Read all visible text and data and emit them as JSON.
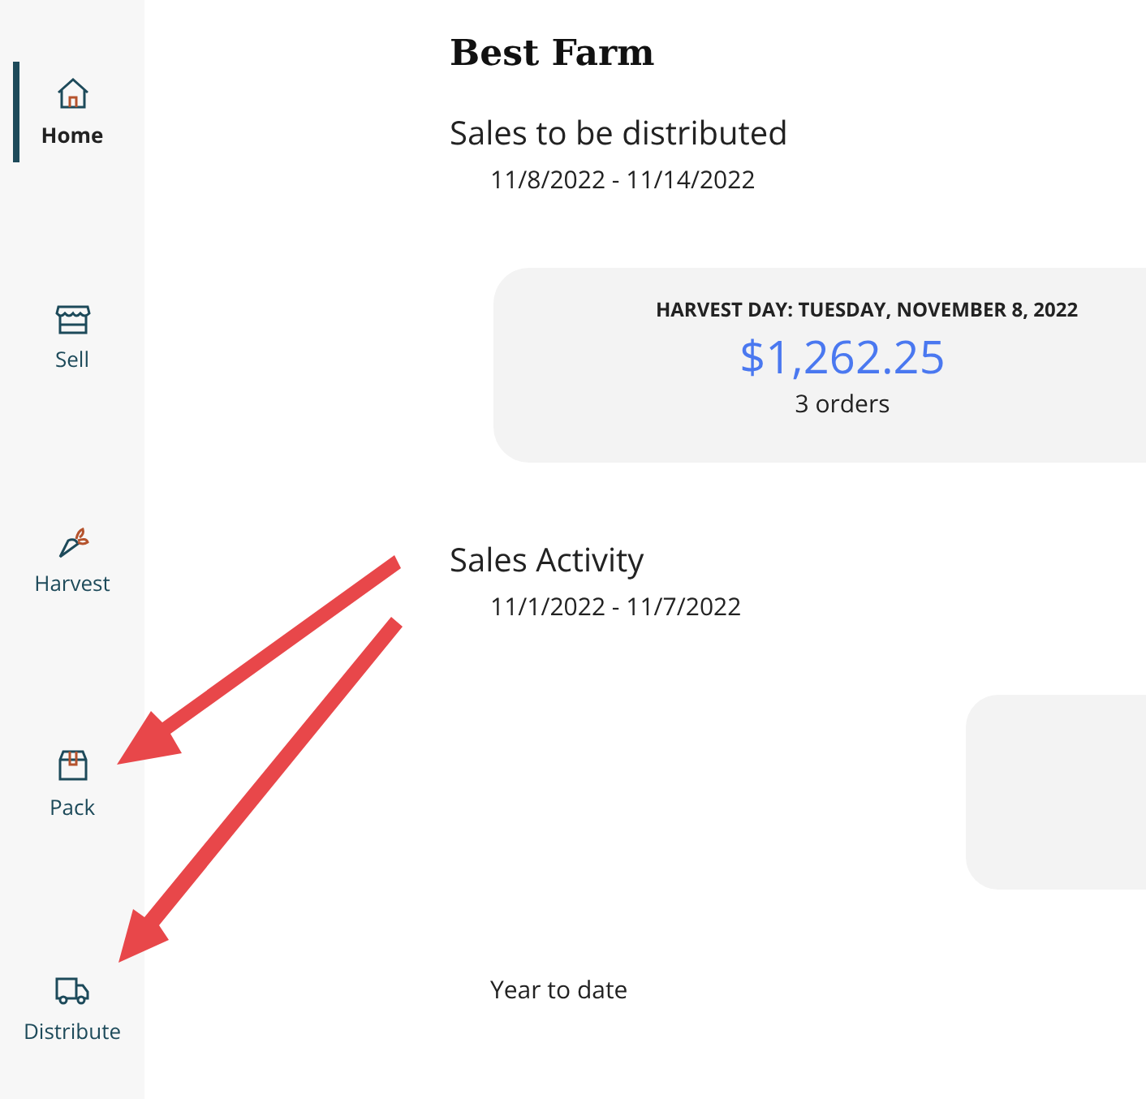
{
  "sidebar": {
    "items": [
      {
        "label": "Home",
        "kind": "home",
        "selected": true
      },
      {
        "label": "Sell",
        "kind": "store",
        "selected": false
      },
      {
        "label": "Harvest",
        "kind": "carrot",
        "selected": false
      },
      {
        "label": "Pack",
        "kind": "box",
        "selected": false
      },
      {
        "label": "Distribute",
        "kind": "truck",
        "selected": false
      }
    ]
  },
  "farm_title": "Best Farm",
  "sales_to_be_distributed": {
    "heading": "Sales to be distributed",
    "date_range": "11/8/2022 - 11/14/2022",
    "card": {
      "title": "HARVEST DAY: TUESDAY, NOVEMBER 8, 2022",
      "amount": "$1,262.25",
      "orders": "3 orders"
    }
  },
  "sales_activity": {
    "heading": "Sales Activity",
    "date_range": "11/1/2022 - 11/7/2022"
  },
  "year_to_date": "Year to date"
}
